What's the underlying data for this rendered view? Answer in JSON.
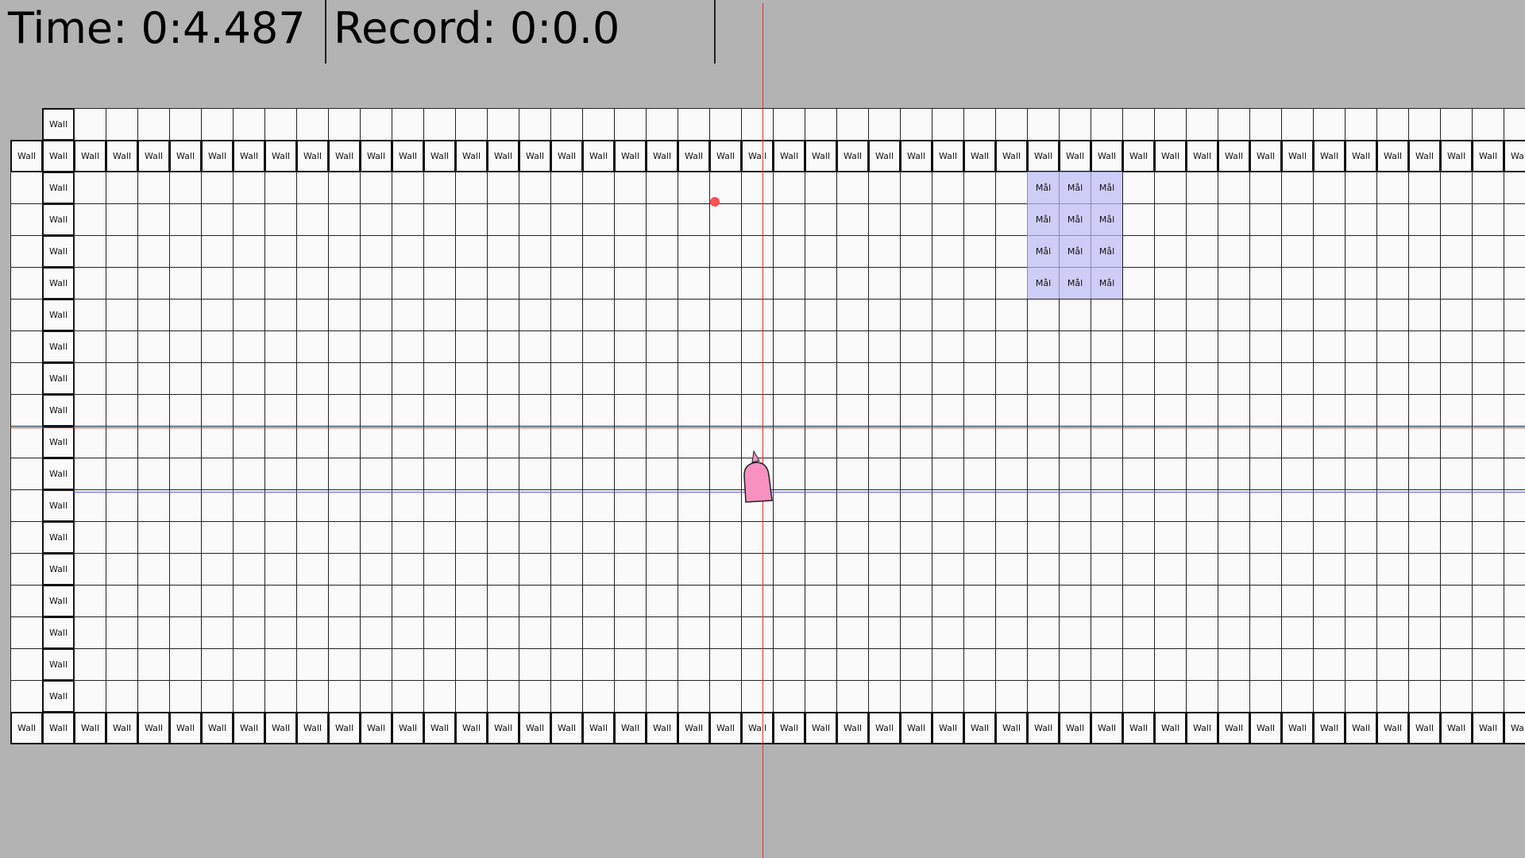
{
  "hud": {
    "time_text": "Time: 0:4.487",
    "record_text": "Record: 0:0.0"
  },
  "board": {
    "wall_label": "Wall",
    "goal_label": "Mål",
    "colors": {
      "background": "#b3b3b3",
      "cell": "#fafafa",
      "goal": "#cdcdf6",
      "player": "#f890c0",
      "red_line": "#e03030",
      "blue_line": "#5060e0",
      "marker": "#ff5050"
    }
  }
}
